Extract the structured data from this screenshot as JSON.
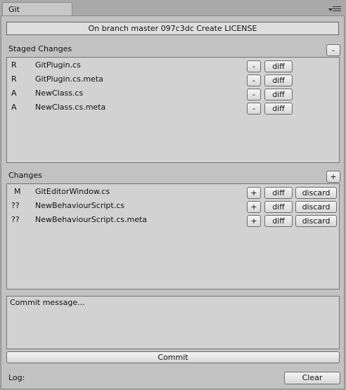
{
  "tab": {
    "title": "Git"
  },
  "branch_info": "On branch master 097c3dc Create LICENSE",
  "staged": {
    "title": "Staged Changes",
    "header_button": "-",
    "items": [
      {
        "status": "R",
        "file": "GitPlugin.cs",
        "unstage": "-",
        "diff": "diff"
      },
      {
        "status": "R",
        "file": "GitPlugin.cs.meta",
        "unstage": "-",
        "diff": "diff"
      },
      {
        "status": "A",
        "file": "NewClass.cs",
        "unstage": "-",
        "diff": "diff"
      },
      {
        "status": "A",
        "file": "NewClass.cs.meta",
        "unstage": "-",
        "diff": "diff"
      }
    ]
  },
  "changes": {
    "title": "Changes",
    "header_button": "+",
    "items": [
      {
        "status": "M",
        "file": "GitEditorWindow.cs",
        "stage": "+",
        "diff": "diff",
        "discard": "discard"
      },
      {
        "status": "??",
        "file": "NewBehaviourScript.cs",
        "stage": "+",
        "diff": "diff",
        "discard": "discard"
      },
      {
        "status": "??",
        "file": "NewBehaviourScript.cs.meta",
        "stage": "+",
        "diff": "diff",
        "discard": "discard"
      }
    ]
  },
  "commit": {
    "placeholder": "Commit message...",
    "button": "Commit"
  },
  "log": {
    "label": "Log:",
    "clear_button": "Clear"
  }
}
